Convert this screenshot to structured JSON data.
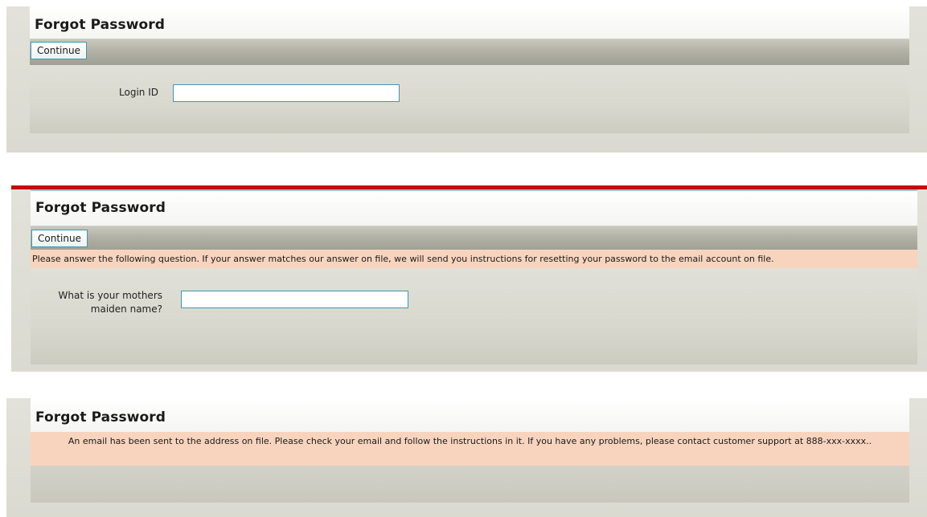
{
  "screens": [
    {
      "title": "Forgot Password",
      "continue_label": "Continue",
      "field_label": "Login ID",
      "field_value": ""
    },
    {
      "title": "Forgot Password",
      "continue_label": "Continue",
      "notice": "Please answer the following question. If your answer matches our answer on file, we will send you instructions for resetting your password to the email account on file.",
      "field_label": "What is your mothers maiden name?",
      "field_value": ""
    },
    {
      "title": "Forgot Password",
      "notice": "An email has been sent to the address on file. Please check your email and follow the instructions in it. If you have any problems, please contact customer support at 888-xxx-xxxx.."
    }
  ],
  "colors": {
    "accent_red": "#c30b0b",
    "input_border": "#3f97b3",
    "notice_background": "#f8d4be"
  }
}
